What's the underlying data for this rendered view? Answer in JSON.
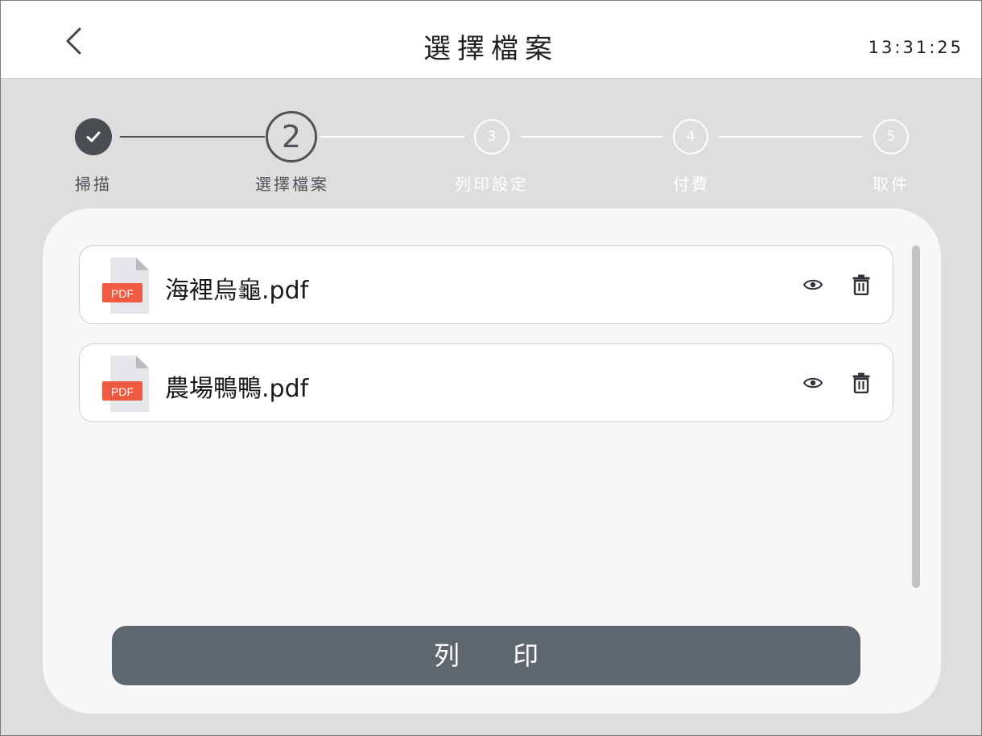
{
  "header": {
    "title": "選擇檔案",
    "clock": "13:31:25",
    "back_icon": "chevron-left-icon"
  },
  "stepper": {
    "steps": [
      {
        "number": "",
        "label": "掃描",
        "status": "done"
      },
      {
        "number": "2",
        "label": "選擇檔案",
        "status": "current"
      },
      {
        "number": "3",
        "label": "列印設定",
        "status": "todo"
      },
      {
        "number": "4",
        "label": "付費",
        "status": "todo"
      },
      {
        "number": "5",
        "label": "取件",
        "status": "todo"
      }
    ]
  },
  "files": [
    {
      "name": "海裡烏龜.pdf",
      "type_badge": "PDF"
    },
    {
      "name": "農場鴨鴨.pdf",
      "type_badge": "PDF"
    }
  ],
  "actions": {
    "print_label": "列 印"
  },
  "colors": {
    "pdf_badge": "#f05a40",
    "primary_button": "#5e666f",
    "step_active": "#4a4d52"
  }
}
